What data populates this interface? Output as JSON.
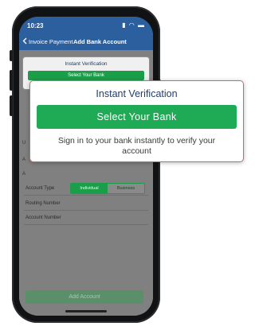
{
  "status_bar": {
    "time": "10:23",
    "icons": "▮ ◠ ▬"
  },
  "nav": {
    "back_label": "Invoice Payment",
    "title": "Add Bank Account"
  },
  "instant_card": {
    "title": "Instant Verification",
    "button_label": "Select Your Bank"
  },
  "form": {
    "peek_1": "U",
    "peek_2": "A",
    "peek_3": "A",
    "account_type_label": "Account Type",
    "account_type_options": [
      "Individual",
      "Business"
    ],
    "account_type_selected": "Individual",
    "routing_label": "Routing Number",
    "account_number_label": "Account Number",
    "add_button_label": "Add Account"
  },
  "popup": {
    "title": "Instant Verification",
    "button_label": "Select Your Bank",
    "description": "Sign in to your bank instantly to verify your account"
  },
  "colors": {
    "nav_blue": "#2b5f9e",
    "green": "#1faa55",
    "popup_border": "#c96b5f"
  }
}
